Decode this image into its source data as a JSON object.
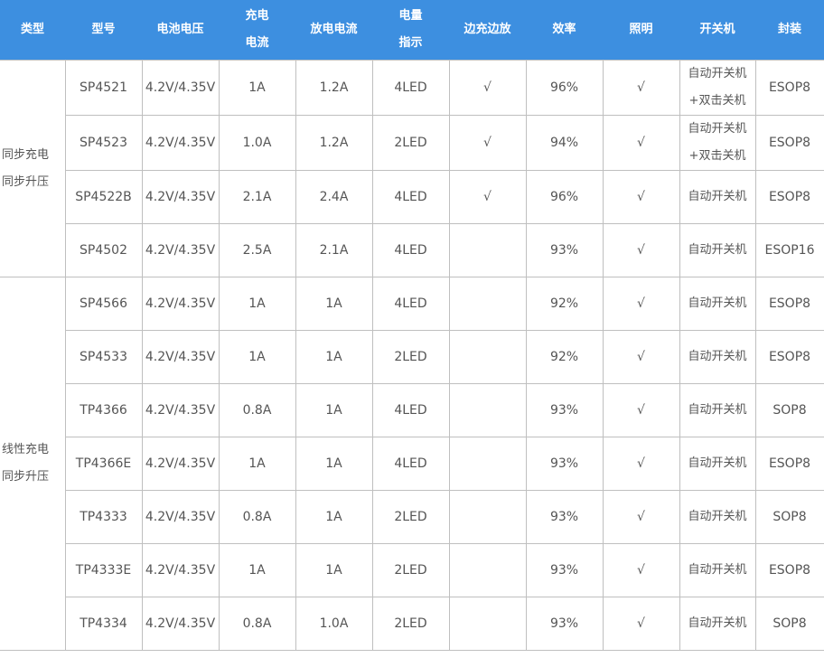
{
  "headers": {
    "type": "类型",
    "model": "型号",
    "battery_voltage": "电池电压",
    "charge_current_l1": "充电",
    "charge_current_l2": "电流",
    "discharge_current": "放电电流",
    "level_l1": "电量",
    "level_l2": "指示",
    "pass_through": "边充边放",
    "efficiency": "效率",
    "lighting": "照明",
    "power_switch": "开关机",
    "package": "封装"
  },
  "groups": [
    {
      "type_l1": "同步充电",
      "type_l2": "同步升压",
      "rows": [
        {
          "model": "SP4521",
          "voltage": "4.2V/4.35V",
          "charge": "1A",
          "discharge": "1.2A",
          "level": "4LED",
          "pass": "√",
          "eff": "96%",
          "light": "√",
          "switch_l1": "自动开关机",
          "switch_l2": "+双击关机",
          "pkg": "ESOP8"
        },
        {
          "model": "SP4523",
          "voltage": "4.2V/4.35V",
          "charge": "1.0A",
          "discharge": "1.2A",
          "level": "2LED",
          "pass": "√",
          "eff": "94%",
          "light": "√",
          "switch_l1": "自动开关机",
          "switch_l2": "+双击关机",
          "pkg": "ESOP8"
        },
        {
          "model": "SP4522B",
          "voltage": "4.2V/4.35V",
          "charge": "2.1A",
          "discharge": "2.4A",
          "level": "4LED",
          "pass": "√",
          "eff": "96%",
          "light": "√",
          "switch_l1": "自动开关机",
          "switch_l2": "",
          "pkg": "ESOP8"
        },
        {
          "model": "SP4502",
          "voltage": "4.2V/4.35V",
          "charge": "2.5A",
          "discharge": "2.1A",
          "level": "4LED",
          "pass": "",
          "eff": "93%",
          "light": "√",
          "switch_l1": "自动开关机",
          "switch_l2": "",
          "pkg": "ESOP16"
        }
      ]
    },
    {
      "type_l1": "线性充电",
      "type_l2": "同步升压",
      "rows": [
        {
          "model": "SP4566",
          "voltage": "4.2V/4.35V",
          "charge": "1A",
          "discharge": "1A",
          "level": "4LED",
          "pass": "",
          "eff": "92%",
          "light": "√",
          "switch_l1": "自动开关机",
          "switch_l2": "",
          "pkg": "ESOP8"
        },
        {
          "model": "SP4533",
          "voltage": "4.2V/4.35V",
          "charge": "1A",
          "discharge": "1A",
          "level": "2LED",
          "pass": "",
          "eff": "92%",
          "light": "√",
          "switch_l1": "自动开关机",
          "switch_l2": "",
          "pkg": "ESOP8"
        },
        {
          "model": "TP4366",
          "voltage": "4.2V/4.35V",
          "charge": "0.8A",
          "discharge": "1A",
          "level": "4LED",
          "pass": "",
          "eff": "93%",
          "light": "√",
          "switch_l1": "自动开关机",
          "switch_l2": "",
          "pkg": "SOP8"
        },
        {
          "model": "TP4366E",
          "voltage": "4.2V/4.35V",
          "charge": "1A",
          "discharge": "1A",
          "level": "4LED",
          "pass": "",
          "eff": "93%",
          "light": "√",
          "switch_l1": "自动开关机",
          "switch_l2": "",
          "pkg": "ESOP8"
        },
        {
          "model": "TP4333",
          "voltage": "4.2V/4.35V",
          "charge": "0.8A",
          "discharge": "1A",
          "level": "2LED",
          "pass": "",
          "eff": "93%",
          "light": "√",
          "switch_l1": "自动开关机",
          "switch_l2": "",
          "pkg": "SOP8"
        },
        {
          "model": "TP4333E",
          "voltage": "4.2V/4.35V",
          "charge": "1A",
          "discharge": "1A",
          "level": "2LED",
          "pass": "",
          "eff": "93%",
          "light": "√",
          "switch_l1": "自动开关机",
          "switch_l2": "",
          "pkg": "ESOP8"
        },
        {
          "model": "TP4334",
          "voltage": "4.2V/4.35V",
          "charge": "0.8A",
          "discharge": "1.0A",
          "level": "2LED",
          "pass": "",
          "eff": "93%",
          "light": "√",
          "switch_l1": "自动开关机",
          "switch_l2": "",
          "pkg": "SOP8"
        }
      ]
    }
  ],
  "colors": {
    "header_bg": "#3d8fe0",
    "header_text": "#ffffff",
    "cell_text": "#555555",
    "border": "#bfbfbf"
  }
}
